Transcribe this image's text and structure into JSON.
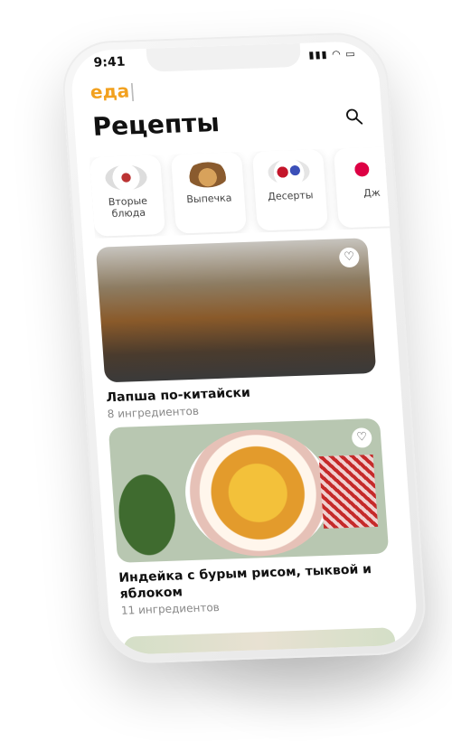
{
  "status": {
    "time": "9:41",
    "icons": "▮▮▮ ◠ ▭"
  },
  "header": {
    "logo": "еда",
    "logo_cursor": "|",
    "title": "Рецепты"
  },
  "categories": [
    {
      "label": "Вторые блюда"
    },
    {
      "label": "Выпечка"
    },
    {
      "label": "Десерты"
    },
    {
      "label": "Дж"
    }
  ],
  "recipes": [
    {
      "name": "Лапша по-китайски",
      "meta": "8 ингредиентов"
    },
    {
      "name": "Индейка с бурым рисом, тыквой и яблоком",
      "meta": "11 ингредиентов"
    }
  ]
}
